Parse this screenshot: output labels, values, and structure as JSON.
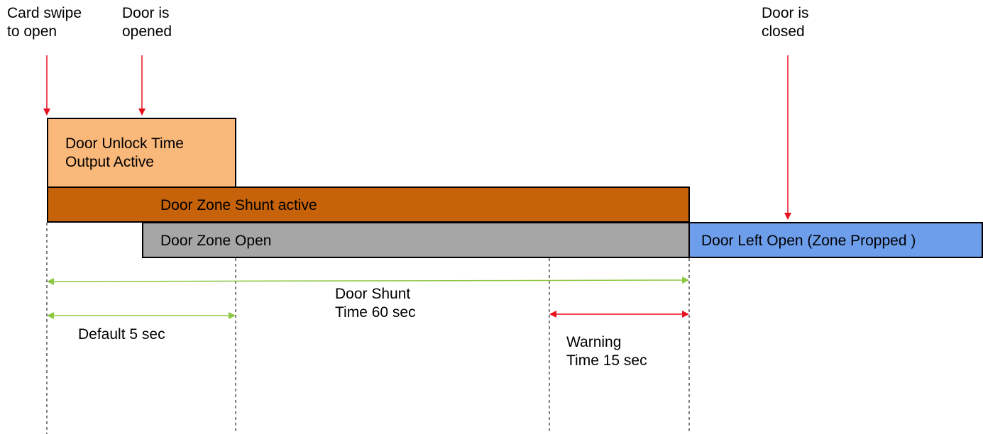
{
  "events": {
    "card_swipe": "Card swipe\nto open",
    "door_opened": "Door is\nopened",
    "door_closed": "Door is\nclosed"
  },
  "bars": {
    "unlock": {
      "label": "Door Unlock Time\nOutput Active",
      "color": "#fab87a"
    },
    "shunt": {
      "label": "Door Zone Shunt active",
      "color": "#c5620a"
    },
    "zone_open": {
      "label": "Door Zone Open",
      "color": "#a6a6a6"
    },
    "propped": {
      "label": "Door Left Open (Zone Propped )",
      "color": "#6d9eeb"
    }
  },
  "durations": {
    "shunt_time": "Door Shunt\nTime 60 sec",
    "default_time": "Default 5 sec",
    "warning_time": "Warning\nTime 15 sec"
  },
  "colors": {
    "event_arrow": "#e8101e",
    "duration_arrow": "#8dc641",
    "warning_arrow": "#e8101e"
  }
}
